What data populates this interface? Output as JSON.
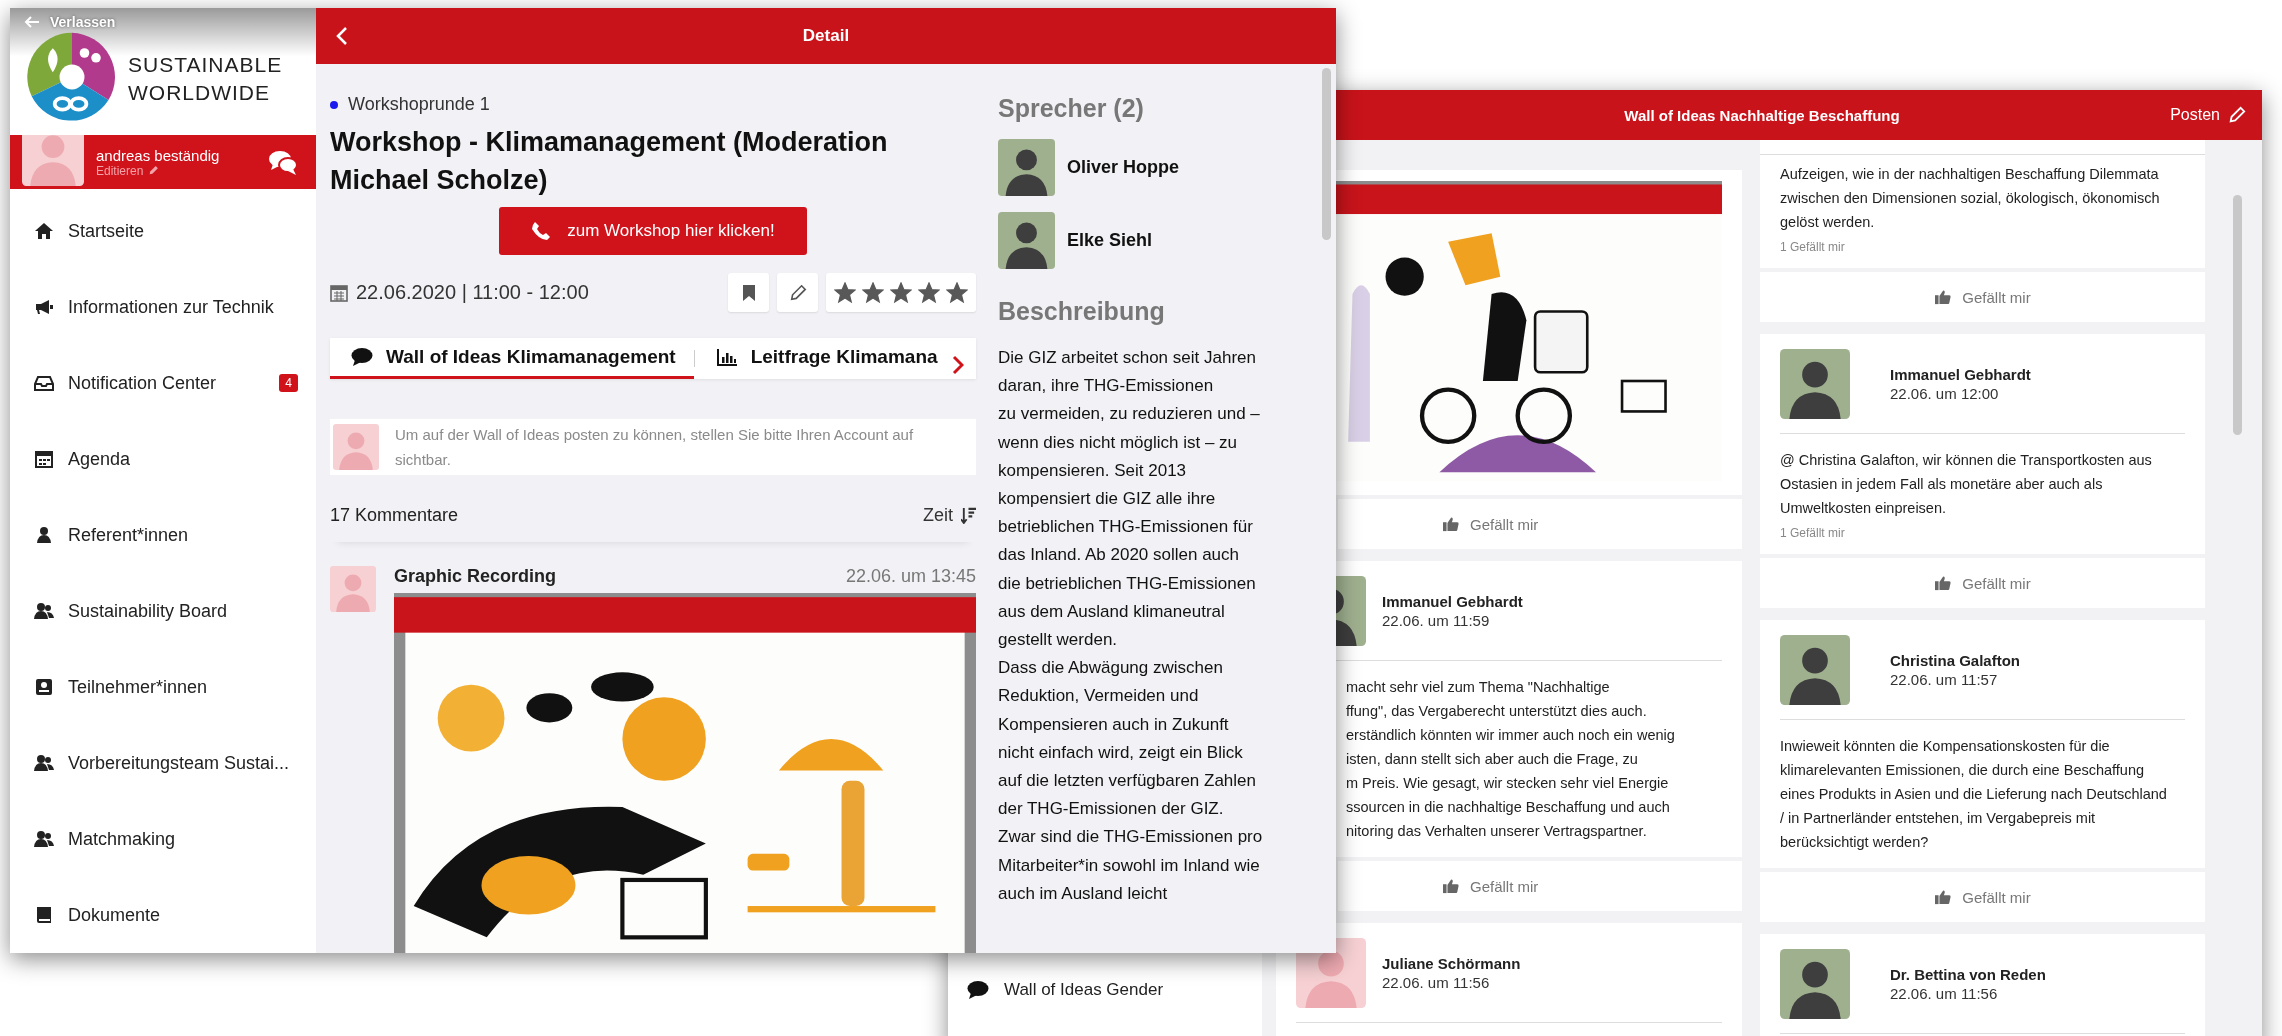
{
  "detail_window": {
    "sidebar": {
      "back_link": "Verlassen",
      "logo_text": "SUSTAINABLE WORLDWIDE",
      "profile": {
        "name": "andreas beständig",
        "edit_label": "Editieren"
      },
      "items": [
        {
          "label": "Startseite",
          "selected": false
        },
        {
          "label": "Informationen zur Technik",
          "selected": false
        },
        {
          "label": "Notification Center",
          "badge": "4",
          "selected": false
        },
        {
          "label": "Agenda",
          "selected": false
        },
        {
          "label": "Referent*innen",
          "selected": false
        },
        {
          "label": "Sustainability Board",
          "selected": false
        },
        {
          "label": "Teilnehmer*innen",
          "selected": false
        },
        {
          "label": "Vorbereitungsteam Sustai...",
          "selected": false
        },
        {
          "label": "Matchmaking",
          "selected": false
        },
        {
          "label": "Dokumente",
          "selected": false
        }
      ]
    },
    "header": {
      "title": "Detail"
    },
    "event": {
      "round": "Workshoprunde 1",
      "title": "Workshop - Klimamanagement (Moderation Michael Scholze)",
      "join_button": "zum Workshop hier klicken!",
      "datetime": "22.06.2020 | 11:00 - 12:00",
      "stars": 5
    },
    "tabs": [
      {
        "label": "Wall of Ideas Klimamanagement",
        "selected": true
      },
      {
        "label": "Leitfrage Klimamana",
        "selected": false
      }
    ],
    "notice": {
      "text": "Um auf der Wall of Ideas posten zu können, stellen Sie bitte Ihren Account auf sichtbar."
    },
    "comments": {
      "count_label": "17 Kommentare",
      "sort_label": "Zeit",
      "items": [
        {
          "author": "Graphic Recording",
          "time": "22.06. um 13:45",
          "kind": "picture"
        }
      ]
    },
    "speakers": {
      "heading": "Sprecher (2)",
      "items": [
        {
          "name": "Oliver Hoppe"
        },
        {
          "name": "Elke Siehl"
        }
      ]
    },
    "description": {
      "heading": "Beschreibung",
      "text": "Die GIZ arbeitet schon seit Jahren\ndaran, ihre THG-Emissionen\nzu vermeiden, zu reduzieren und –\nwenn dies nicht möglich ist – zu\nkompensieren. Seit 2013\nkompensiert die GIZ alle ihre\nbetrieblichen THG-Emissionen für\ndas Inland. Ab 2020 sollen auch\ndie betrieblichen THG-Emissionen\naus dem Ausland klimaneutral\ngestellt werden.\nDass die Abwägung zwischen\nReduktion, Vermeiden und\nKompensieren auch in Zukunft\nnicht einfach wird, zeigt ein Blick\nauf die letzten verfügbaren Zahlen\nder THG-Emissionen der GIZ.\nZwar sind die THG-Emissionen pro\nMitarbeiter*in sowohl im Inland wie\nauch im Ausland leicht"
    }
  },
  "wall_window": {
    "sidebar_items": [
      {
        "label": "Wall of Ideas Gender",
        "selected": false
      }
    ],
    "header": {
      "title": "Wall of Ideas Nachhaltige Beschaffung",
      "post_button": "Posten"
    },
    "columns": [
      [
        {
          "kind": "picture",
          "like_button": "Gefällt mir"
        },
        {
          "author": "Immanuel Gebhardt",
          "time": "22.06. um 11:59",
          "text": "macht sehr viel zum Thema \"Nachhaltige\nffung\", das Vergaberecht unterstützt dies auch.\nerständlich könnten wir immer auch noch ein wenig\nisten, dann stellt sich aber auch die Frage, zu\nm Preis. Wie gesagt, wir stecken sehr viel Energie\nssourcen in die nachhaltige Beschaffung und auch\nnitoring das Verhalten unserer Vertragspartner.",
          "like_button": "Gefällt mir"
        },
        {
          "author": "Juliane Schörmann",
          "time": "22.06. um 11:56"
        }
      ],
      [
        {
          "text": "Aufzeigen, wie in der nachhaltigen Beschaffung Dilemmata\nzwischen den Dimensionen sozial, ökologisch, ökonomisch\ngelöst werden.",
          "likes": "1 Gefällt mir",
          "like_button": "Gefällt mir"
        },
        {
          "author": "Immanuel Gebhardt",
          "time": "22.06. um 12:00",
          "text": "@ Christina Galafton, wir können die Transportkosten aus\nOstasien in jedem Fall als monetäre aber auch als\nUmweltkosten einpreisen.",
          "likes": "1 Gefällt mir",
          "like_button": "Gefällt mir"
        },
        {
          "author": "Christina Galafton",
          "time": "22.06. um 11:57",
          "text": "Inwieweit könnten die Kompensationskosten für die\nklimarelevanten Emissionen, die durch eine Beschaffung\neines Produkts in Asien und die Lieferung nach Deutschland\n/ in Partnerländer entstehen, im Vergabepreis mit\nberücksichtigt werden?",
          "like_button": "Gefällt mir"
        },
        {
          "author": "Dr. Bettina von Reden",
          "time": "22.06. um 11:56"
        }
      ]
    ]
  }
}
